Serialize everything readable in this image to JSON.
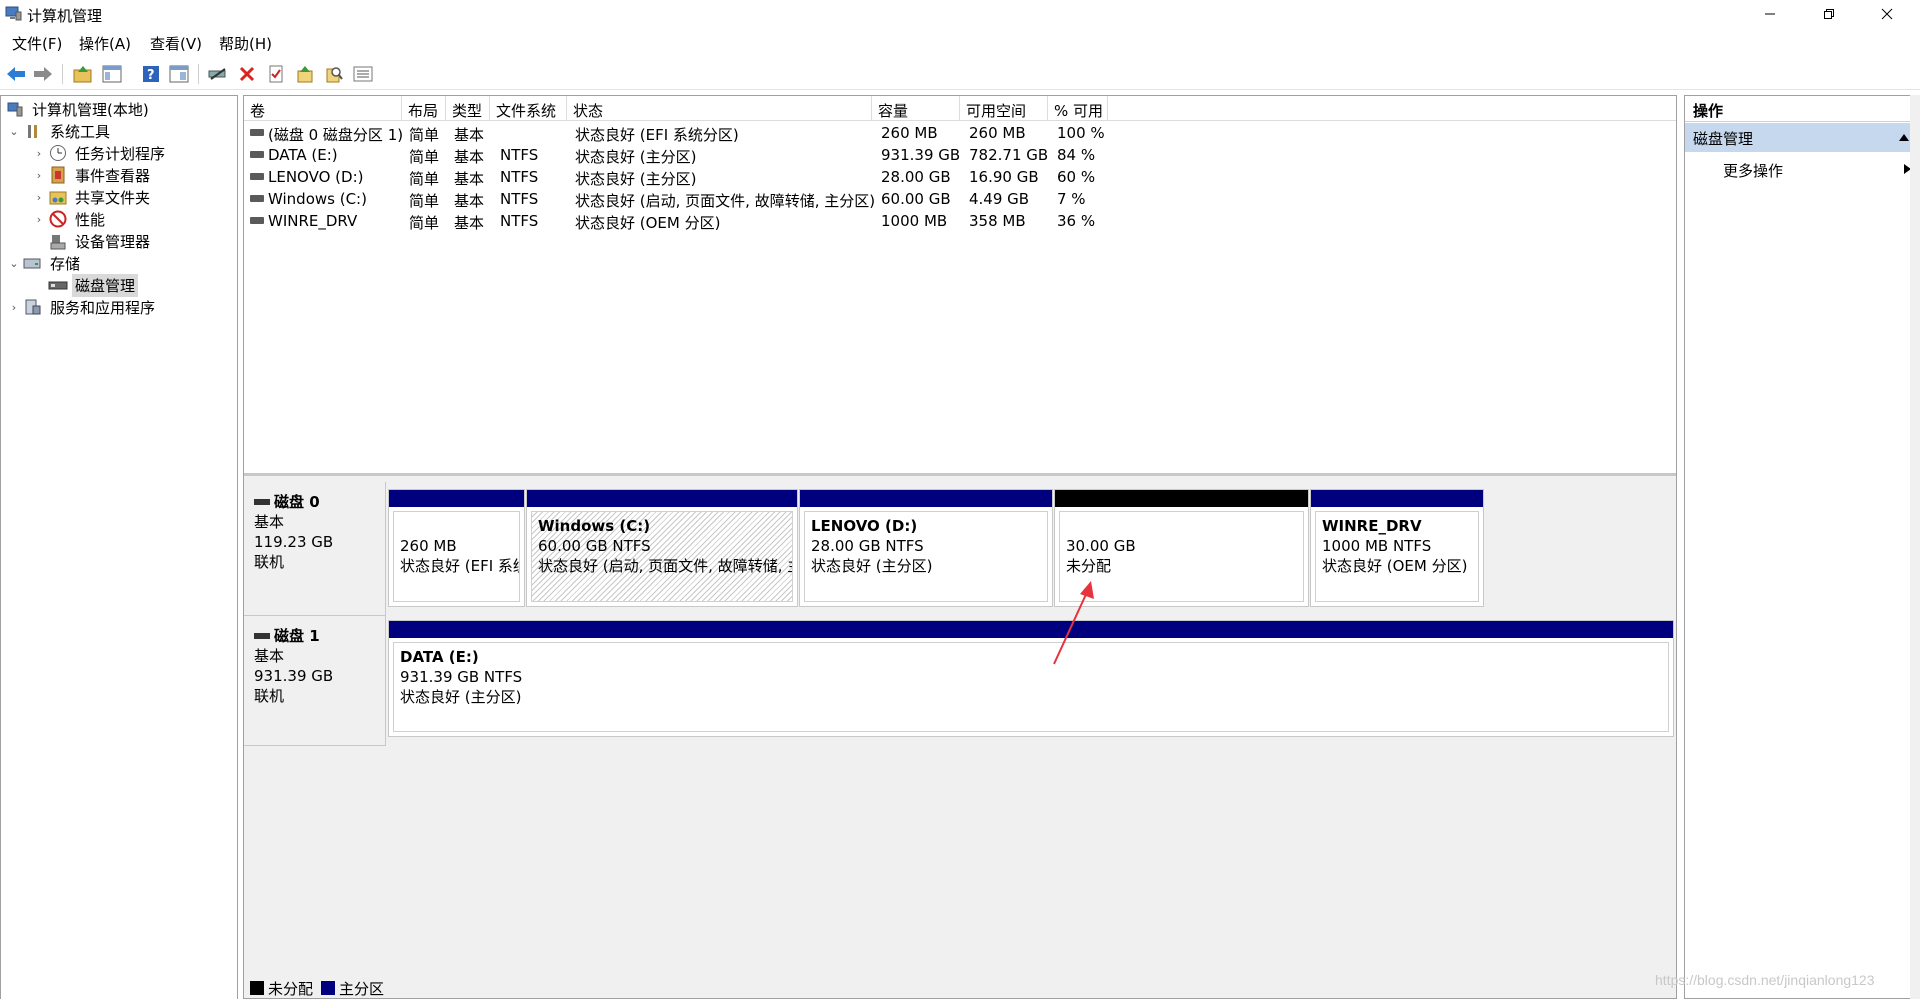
{
  "window": {
    "title": "计算机管理"
  },
  "menu": [
    "文件(F)",
    "操作(A)",
    "查看(V)",
    "帮助(H)"
  ],
  "toolbar": {
    "icons": [
      "back-icon",
      "forward-icon",
      "up-icon",
      "show-hide-tree-icon",
      "help-icon",
      "view-icon",
      "connect-icon",
      "delete-icon",
      "properties-icon",
      "export-icon",
      "search-icon",
      "list-icon"
    ]
  },
  "tree": {
    "root": "计算机管理(本地)",
    "system_tools": "系统工具",
    "task_scheduler": "任务计划程序",
    "event_viewer": "事件查看器",
    "shared_folders": "共享文件夹",
    "performance": "性能",
    "device_manager": "设备管理器",
    "storage": "存储",
    "disk_management": "磁盘管理",
    "services_apps": "服务和应用程序"
  },
  "volumes": {
    "headers": {
      "volume": "卷",
      "layout": "布局",
      "type": "类型",
      "fs": "文件系统",
      "status": "状态",
      "capacity": "容量",
      "free": "可用空间",
      "pct": "% 可用"
    },
    "rows": [
      {
        "volume": "(磁盘 0 磁盘分区 1)",
        "layout": "简单",
        "type": "基本",
        "fs": "",
        "status": "状态良好 (EFI 系统分区)",
        "capacity": "260 MB",
        "free": "260 MB",
        "pct": "100 %"
      },
      {
        "volume": "DATA (E:)",
        "layout": "简单",
        "type": "基本",
        "fs": "NTFS",
        "status": "状态良好 (主分区)",
        "capacity": "931.39 GB",
        "free": "782.71 GB",
        "pct": "84 %"
      },
      {
        "volume": "LENOVO (D:)",
        "layout": "简单",
        "type": "基本",
        "fs": "NTFS",
        "status": "状态良好 (主分区)",
        "capacity": "28.00 GB",
        "free": "16.90 GB",
        "pct": "60 %"
      },
      {
        "volume": "Windows (C:)",
        "layout": "简单",
        "type": "基本",
        "fs": "NTFS",
        "status": "状态良好 (启动, 页面文件, 故障转储, 主分区)",
        "capacity": "60.00 GB",
        "free": "4.49 GB",
        "pct": "7 %"
      },
      {
        "volume": "WINRE_DRV",
        "layout": "简单",
        "type": "基本",
        "fs": "NTFS",
        "status": "状态良好 (OEM 分区)",
        "capacity": "1000 MB",
        "free": "358 MB",
        "pct": "36 %"
      }
    ]
  },
  "disks": {
    "disk0": {
      "name": "磁盘 0",
      "kind": "基本",
      "size": "119.23 GB",
      "state": "联机",
      "partitions": {
        "efi": {
          "size": "260 MB",
          "status": "状态良好 (EFI 系统"
        },
        "windows": {
          "name": "Windows  (C:)",
          "size": "60.00 GB NTFS",
          "status": "状态良好 (启动, 页面文件, 故障转储, 主"
        },
        "lenovo": {
          "name": "LENOVO  (D:)",
          "size": "28.00 GB NTFS",
          "status": "状态良好 (主分区)"
        },
        "unalloc": {
          "size": "30.00 GB",
          "status": "未分配"
        },
        "winre": {
          "name": "WINRE_DRV",
          "size": "1000 MB NTFS",
          "status": "状态良好 (OEM 分区)"
        }
      }
    },
    "disk1": {
      "name": "磁盘 1",
      "kind": "基本",
      "size": "931.39 GB",
      "state": "联机",
      "partitions": {
        "data": {
          "name": "DATA  (E:)",
          "size": "931.39 GB NTFS",
          "status": "状态良好 (主分区)"
        }
      }
    }
  },
  "legend": {
    "unallocated": "未分配",
    "primary": "主分区"
  },
  "colors": {
    "primary": "#00007f",
    "unallocated": "#000000",
    "selected_action": "#c6d8ee",
    "annotation_arrow": "#e8323c"
  },
  "actions": {
    "header": "操作",
    "section": "磁盘管理",
    "more": "更多操作"
  },
  "watermark": "https://blog.csdn.net/jinqianlong123"
}
